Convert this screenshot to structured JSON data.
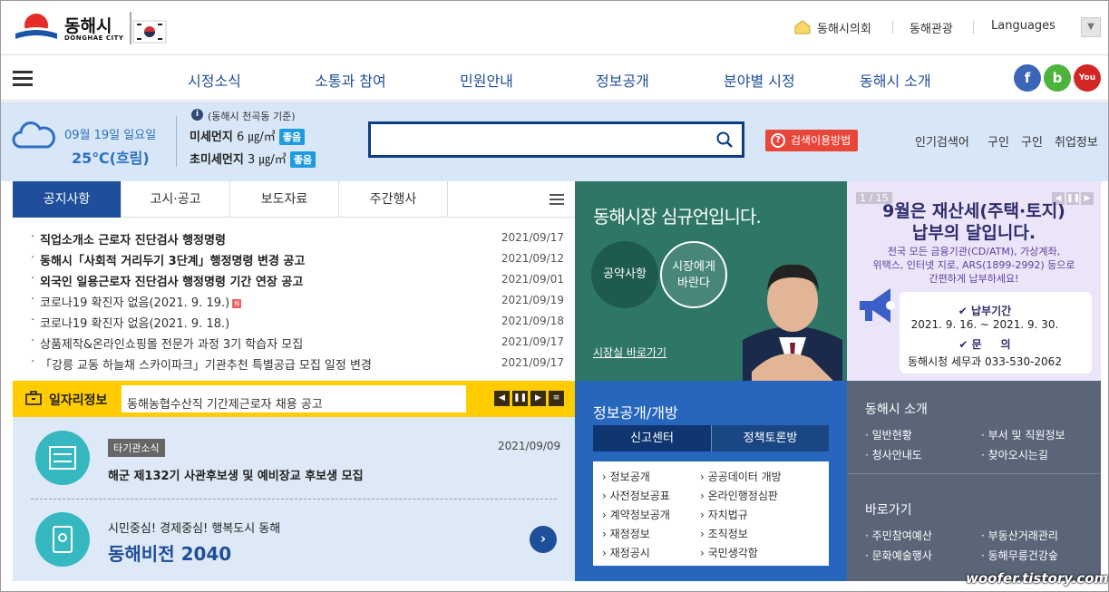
{
  "header": {
    "logo_text": "동해시",
    "logo_sub": "DONGHAE CITY",
    "links": [
      "동해시의회",
      "동해관광",
      "Languages"
    ]
  },
  "nav": {
    "items": [
      "시정소식",
      "소통과 참여",
      "민원안내",
      "정보공개",
      "분야별 시정",
      "동해시 소개"
    ],
    "sns": {
      "facebook": "f",
      "blog": "b",
      "youtube": "You"
    }
  },
  "weather": {
    "date": "09월 19일 일요일",
    "temp": "25℃(흐림)",
    "dust_caption": "(동해시 천곡동 기준)",
    "fine_dust_label": "미세먼지",
    "fine_dust_value": "6 ㎍/㎥",
    "fine_dust_status": "좋음",
    "ultra_dust_label": "초미세먼지",
    "ultra_dust_value": "3 ㎍/㎥",
    "ultra_dust_status": "좋음"
  },
  "search": {
    "placeholder": "",
    "howto": "검색이용방법",
    "popular_label": "인기검색어",
    "popular": [
      "구인",
      "구인",
      "취업정보"
    ]
  },
  "notice": {
    "tabs": [
      "공지사항",
      "고시·공고",
      "보도자료",
      "주간행사"
    ],
    "items": [
      {
        "title": "직업소개소 근로자 진단검사 행정명령",
        "date": "2021/09/17"
      },
      {
        "title": "동해시「사회적 거리두기 3단계」행정명령 변경 공고",
        "date": "2021/09/12"
      },
      {
        "title": "외국인 일용근로자 진단검사 행정명령 기간 연장 공고",
        "date": "2021/09/01"
      },
      {
        "title": "코로나19 확진자 없음(2021. 9. 19.)",
        "date": "2021/09/19"
      },
      {
        "title": "코로나19 확진자 없음(2021. 9. 18.)",
        "date": "2021/09/18"
      },
      {
        "title": "상품제작&온라인쇼핑몰 전문가 과정 3기 학습자 모집",
        "date": "2021/09/17"
      },
      {
        "title": "「강릉 교동 하늘채 스카이파크」기관추천 특별공급 모집 일정 변경",
        "date": "2021/09/17"
      }
    ],
    "new_badge": "N"
  },
  "jobs": {
    "title": "일자리정보",
    "text": "동해농협수산직 기간제근로자 채용 공고"
  },
  "other_agency": {
    "tag": "타기관소식",
    "title": "해군 제132기 사관후보생 및 예비장교 후보생 모집",
    "date": "2021/09/09"
  },
  "vision": {
    "sub": "시민중심! 경제중심! 행복도시 동해",
    "title": "동해비전 2040"
  },
  "mayor": {
    "title": "동해시장 심규언입니다.",
    "btn1": "공약사항",
    "btn2_line1": "시장에게",
    "btn2_line2": "바란다",
    "link": "시장실 바로가기"
  },
  "tax": {
    "page": "1 / 15",
    "heading1": "9월은 재산세(주택·토지)",
    "heading2": "납부의 달입니다.",
    "desc1": "전국 모든 금융기관(CD/ATM), 가상계좌,",
    "desc2": "위택스, 인터넷 지로, ARS(1899-2992) 등으로",
    "desc3": "간편하게 납부하세요!",
    "period_label": "납부기간",
    "period": "2021. 9. 16. ~ 2021. 9. 30.",
    "contact_label": "문     의",
    "contact": "동해시청 세무과 033-530-2062"
  },
  "disclosure": {
    "title": "정보공개/개방",
    "tabs": [
      "신고센터",
      "정책토론방"
    ],
    "left": [
      "정보공개",
      "사전정보공표",
      "계약정보공개",
      "재정정보",
      "재정공시"
    ],
    "right": [
      "공공데이터 개방",
      "온라인행정심판",
      "자치법규",
      "조직정보",
      "국민생각함"
    ]
  },
  "about": {
    "title": "동해시 소개",
    "items": [
      "일반현황",
      "부서 및 직원정보",
      "청사안내도",
      "찾아오시는길"
    ],
    "shortcut_title": "바로가기",
    "shortcuts": [
      "주민참여예산",
      "부동산거래관리",
      "문화예술행사",
      "동해무릉건강숲"
    ]
  },
  "watermark": "woofer.tistory.com",
  "colors": {
    "primary": "#1f4e9a",
    "yellow": "#ffcc00",
    "teal": "#2e7666",
    "blue": "#2666bd"
  }
}
